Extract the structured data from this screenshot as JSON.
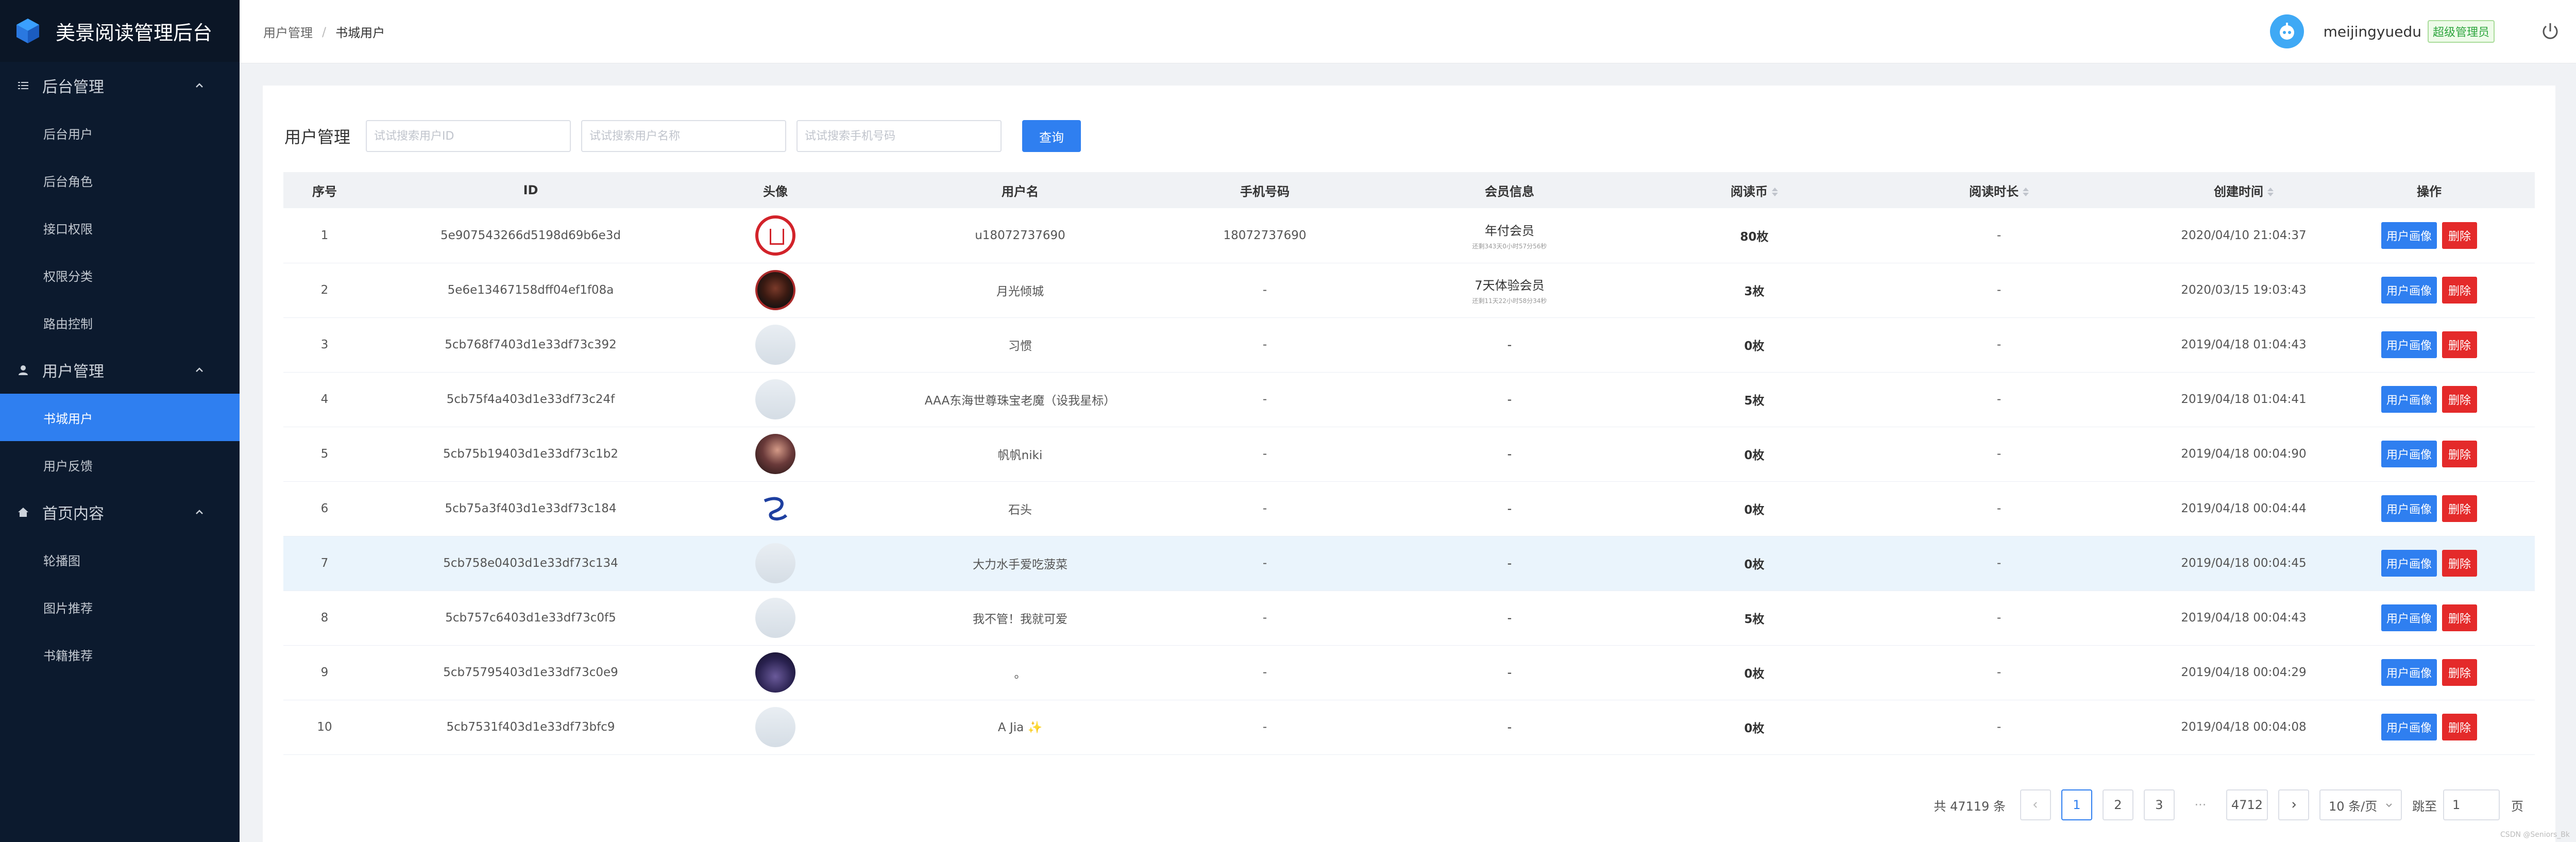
{
  "brand": {
    "title": "美景阅读管理后台"
  },
  "sidebar": {
    "groups": [
      {
        "label": "后台管理",
        "icon": "menu-lines-icon",
        "items": [
          "后台用户",
          "后台角色",
          "接口权限",
          "权限分类",
          "路由控制"
        ]
      },
      {
        "label": "用户管理",
        "icon": "user-icon",
        "items": [
          "书城用户",
          "用户反馈"
        ]
      },
      {
        "label": "首页内容",
        "icon": "home-icon",
        "items": [
          "轮播图",
          "图片推荐",
          "书籍推荐"
        ]
      }
    ],
    "active_item": "书城用户",
    "colors": {
      "bg": "#0c1a2e",
      "active": "#2f7ff0"
    }
  },
  "header": {
    "breadcrumb": [
      "用户管理",
      "书城用户"
    ],
    "username": "meijingyuedu",
    "role": "超级管理员"
  },
  "toolbar": {
    "title": "用户管理",
    "placeholders": [
      "试试搜索用户ID",
      "试试搜索用户名称",
      "试试搜索手机号码"
    ],
    "query": "查询"
  },
  "table": {
    "columns": [
      "序号",
      "ID",
      "头像",
      "用户名",
      "手机号码",
      "会员信息",
      "阅读币",
      "阅读时长",
      "创建时间",
      "操作"
    ],
    "rows": [
      {
        "no": "1",
        "id": "5e907543266d5198d69b6e3d",
        "avatar": "red-logo",
        "name": "u18072737690",
        "phone": "18072737690",
        "vip": "年付会员",
        "vip_sub": "还剩343天0小时57分56秒",
        "coin": "80枚",
        "duration": "-",
        "created": "2020/04/10 21:04:37"
      },
      {
        "no": "2",
        "id": "5e6e13467158dff04ef1f08a",
        "avatar": "dark",
        "name": "月光倾城",
        "phone": "-",
        "vip": "7天体验会员",
        "vip_sub": "还剩11天22小时58分34秒",
        "coin": "3枚",
        "duration": "-",
        "created": "2020/03/15 19:03:43"
      },
      {
        "no": "3",
        "id": "5cb768f7403d1e33df73c392",
        "avatar": "placeholder",
        "name": "习惯",
        "phone": "-",
        "vip": "-",
        "vip_sub": "",
        "coin": "0枚",
        "duration": "-",
        "created": "2019/04/18 01:04:43"
      },
      {
        "no": "4",
        "id": "5cb75f4a403d1e33df73c24f",
        "avatar": "placeholder",
        "name": "AAA东海世尊珠宝老魔（设我星标）",
        "phone": "-",
        "vip": "-",
        "vip_sub": "",
        "coin": "5枚",
        "duration": "-",
        "created": "2019/04/18 01:04:41"
      },
      {
        "no": "5",
        "id": "5cb75b19403d1e33df73c1b2",
        "avatar": "girl",
        "name": "帆帆niki",
        "phone": "-",
        "vip": "-",
        "vip_sub": "",
        "coin": "0枚",
        "duration": "-",
        "created": "2019/04/18 00:04:90"
      },
      {
        "no": "6",
        "id": "5cb75a3f403d1e33df73c184",
        "avatar": "logo5",
        "name": "石头",
        "phone": "-",
        "vip": "-",
        "vip_sub": "",
        "coin": "0枚",
        "duration": "-",
        "created": "2019/04/18 00:04:44"
      },
      {
        "no": "7",
        "id": "5cb758e0403d1e33df73c134",
        "avatar": "placeholder",
        "name": "大力水手爱吃菠菜",
        "phone": "-",
        "vip": "-",
        "vip_sub": "",
        "coin": "0枚",
        "duration": "-",
        "created": "2019/04/18 00:04:45"
      },
      {
        "no": "8",
        "id": "5cb757c6403d1e33df73c0f5",
        "avatar": "placeholder",
        "name": "我不管！我就可爱",
        "phone": "-",
        "vip": "-",
        "vip_sub": "",
        "coin": "5枚",
        "duration": "-",
        "created": "2019/04/18 00:04:43"
      },
      {
        "no": "9",
        "id": "5cb75795403d1e33df73c0e9",
        "avatar": "night",
        "name": "。",
        "phone": "-",
        "vip": "-",
        "vip_sub": "",
        "coin": "0枚",
        "duration": "-",
        "created": "2019/04/18 00:04:29"
      },
      {
        "no": "10",
        "id": "5cb7531f403d1e33df73bfc9",
        "avatar": "placeholder",
        "name": "A Jia ✨",
        "phone": "-",
        "vip": "-",
        "vip_sub": "",
        "coin": "0枚",
        "duration": "-",
        "created": "2019/04/18 00:04:08"
      }
    ],
    "actions": {
      "portrait": "用户画像",
      "delete": "删除"
    }
  },
  "pagination": {
    "total": "共 47119 条",
    "pages": [
      "1",
      "2",
      "3"
    ],
    "more": "···",
    "last": "4712",
    "page_size": "10 条/页",
    "jump_label": "跳至",
    "jump_value": "1",
    "page_unit": "页"
  },
  "watermark": "CSDN @Seniors_Bk"
}
